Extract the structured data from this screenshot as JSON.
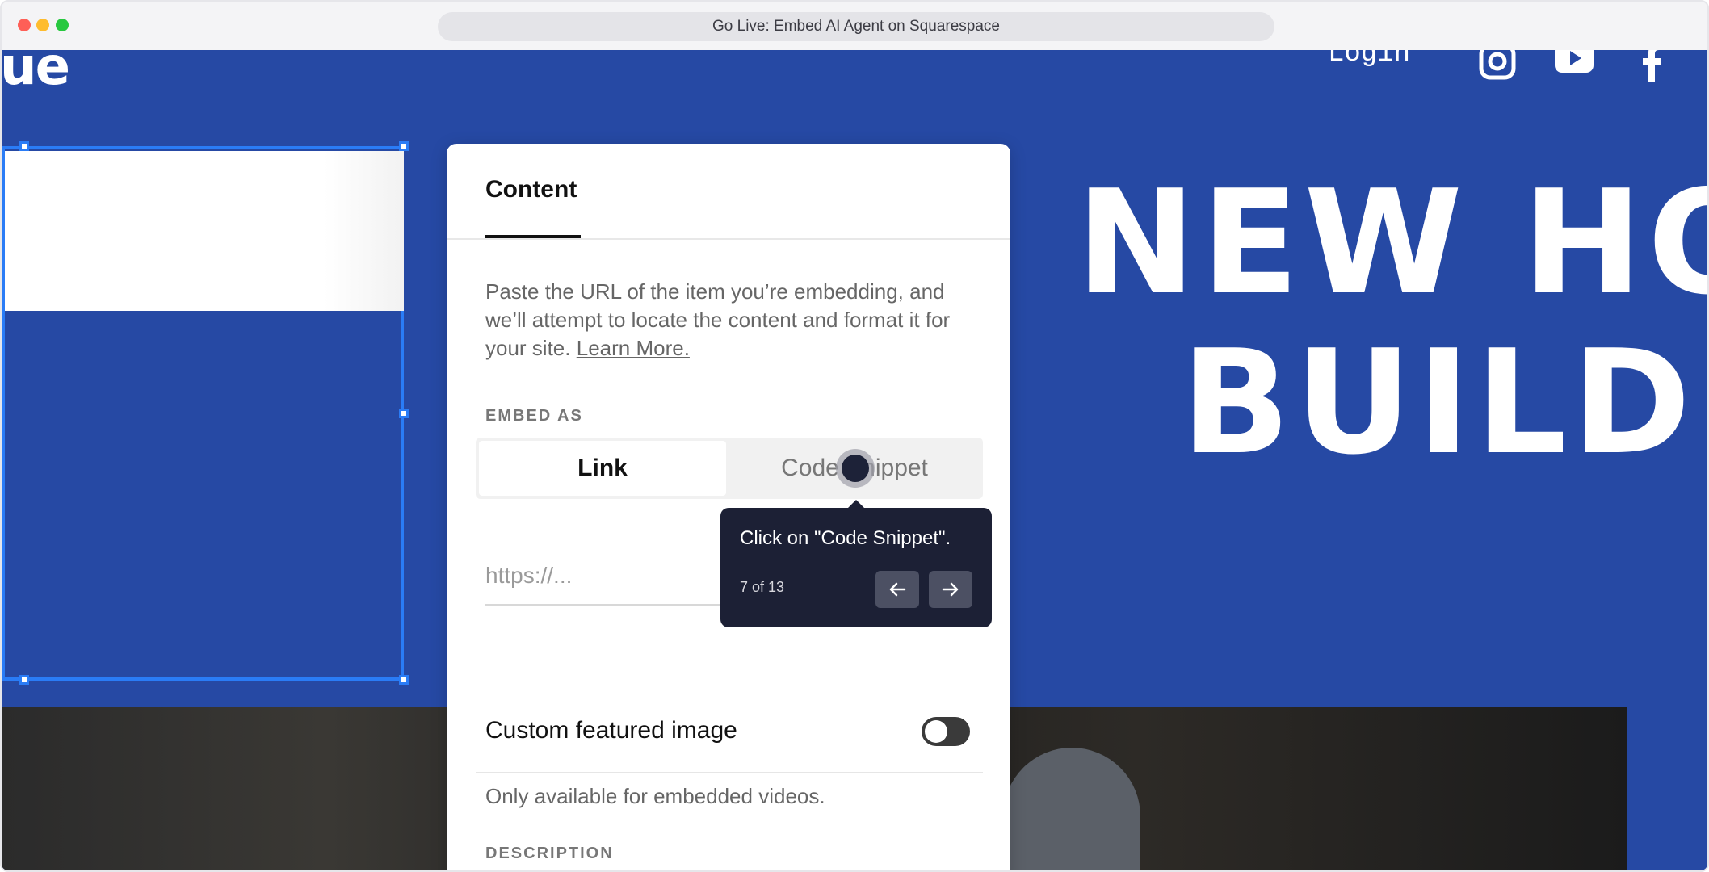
{
  "browser": {
    "title": "Go Live: Embed AI Agent on Squarespace"
  },
  "site": {
    "logo_fragment": "ue",
    "nav_login": "Login",
    "social_icons": [
      "instagram-icon",
      "youtube-icon",
      "facebook-icon"
    ],
    "hero_line1": "NEW HO",
    "hero_line2": "BUILDE"
  },
  "panel": {
    "tab_label": "Content",
    "description": "Paste the URL of the item you’re embedding, and we’ll attempt to locate the content and format it for your site.",
    "learn_more": "Learn More.",
    "embed_as_label": "EMBED AS",
    "embed_options": [
      "Link",
      "Code Snippet"
    ],
    "selected_option": "Link",
    "url_placeholder": "https://...",
    "custom_featured_label": "Custom featured image",
    "custom_featured_enabled": false,
    "custom_featured_note": "Only available for embedded videos.",
    "description_label": "DESCRIPTION"
  },
  "tooltip": {
    "message": "Click on \"Code Snippet\".",
    "step": "7 of 13"
  },
  "colors": {
    "site_background": "#2649a4",
    "selection_accent": "#2a7cf6",
    "tooltip_background": "#1c2035"
  }
}
